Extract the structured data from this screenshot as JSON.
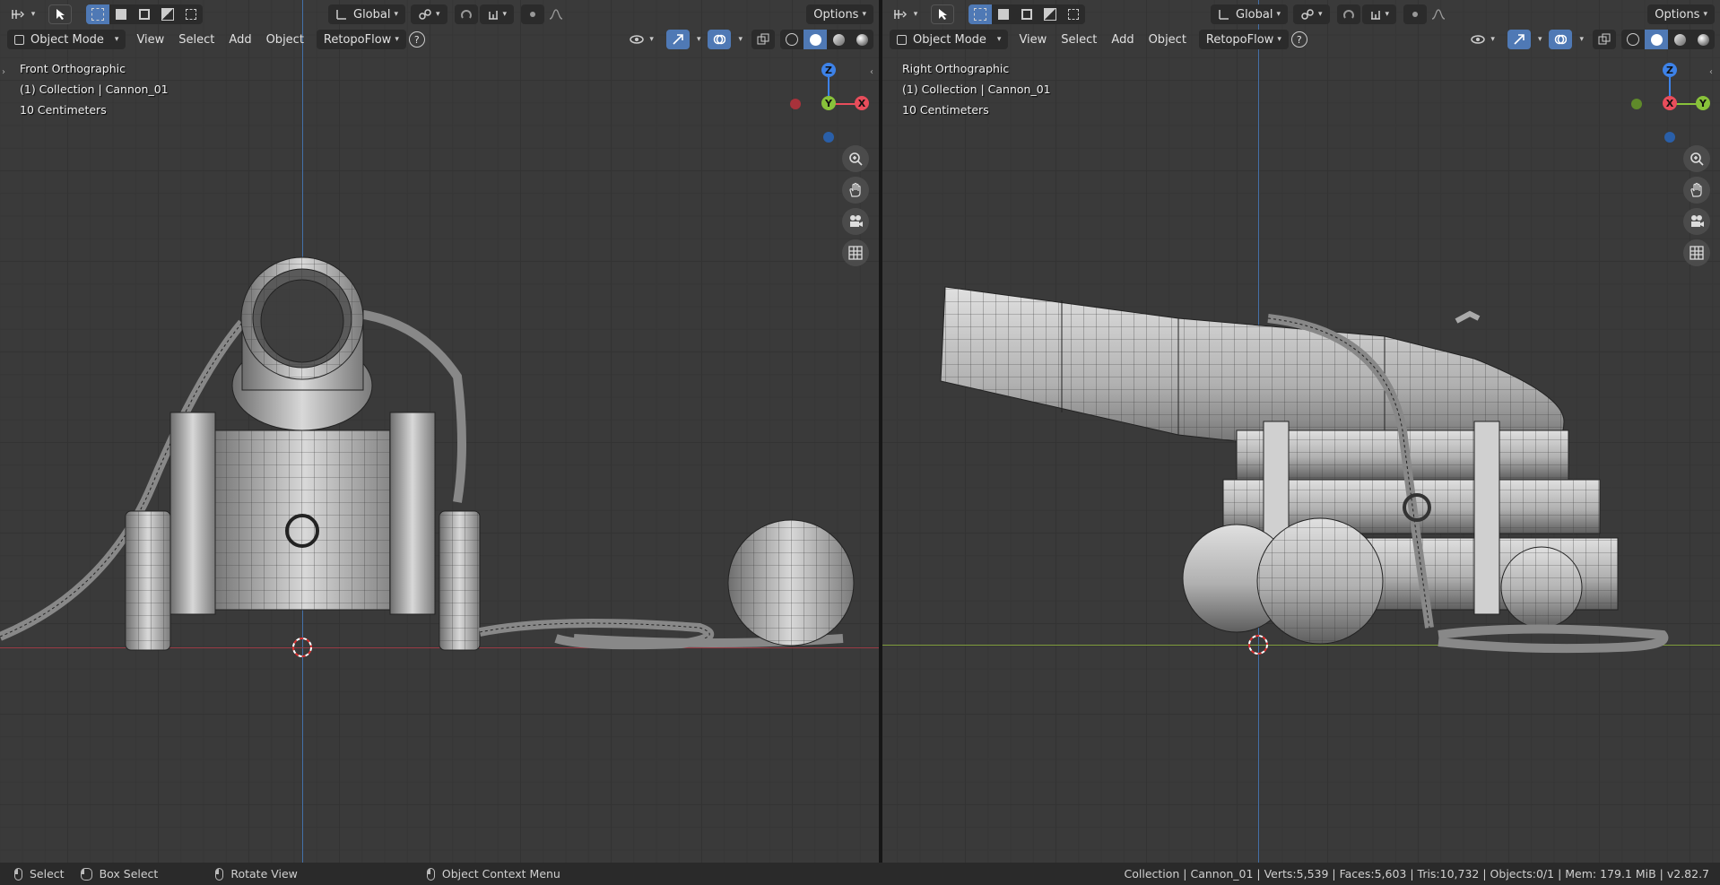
{
  "header": {
    "transform_orientation": "Global",
    "options_label": "Options",
    "mode": "Object Mode",
    "menus": [
      "View",
      "Select",
      "Add",
      "Object"
    ],
    "addon_menu": "RetopoFlow",
    "help_glyph": "?"
  },
  "viewports": {
    "left": {
      "view_name": "Front Orthographic",
      "collection_info": "(1) Collection | Cannon_01",
      "scale_info": "10 Centimeters",
      "gizmo": {
        "up": "Z",
        "center": "Y",
        "right": "X"
      }
    },
    "right": {
      "view_name": "Right Orthographic",
      "collection_info": "(1) Collection | Cannon_01",
      "scale_info": "10 Centimeters",
      "gizmo": {
        "up": "Z",
        "center": "X",
        "right": "Y"
      }
    }
  },
  "statusbar": {
    "select": "Select",
    "box_select": "Box Select",
    "rotate_view": "Rotate View",
    "context_menu": "Object Context Menu",
    "stats": "Collection | Cannon_01 | Verts:5,539 | Faces:5,603 | Tris:10,732 | Objects:0/1 | Mem: 179.1 MiB | v2.82.7"
  },
  "colors": {
    "axis_x": "#e84d5b",
    "axis_y": "#88c23a",
    "axis_z": "#3d82e8",
    "active_button": "#4f79b5",
    "viewport_bg": "#3a3a3a"
  },
  "icons": [
    "editor-type-icon",
    "select-cursor-icon",
    "selection-mode-icons",
    "orientation-icon",
    "pivot-icon",
    "snap-icon",
    "proportional-edit-icon",
    "visibility-icon",
    "gizmo-icon",
    "overlay-icon",
    "xray-icon",
    "shading-wireframe-icon",
    "shading-solid-icon",
    "shading-material-icon",
    "shading-rendered-icon",
    "zoom-icon",
    "hand-pan-icon",
    "camera-icon",
    "grid-ortho-icon",
    "mouse-icon"
  ]
}
